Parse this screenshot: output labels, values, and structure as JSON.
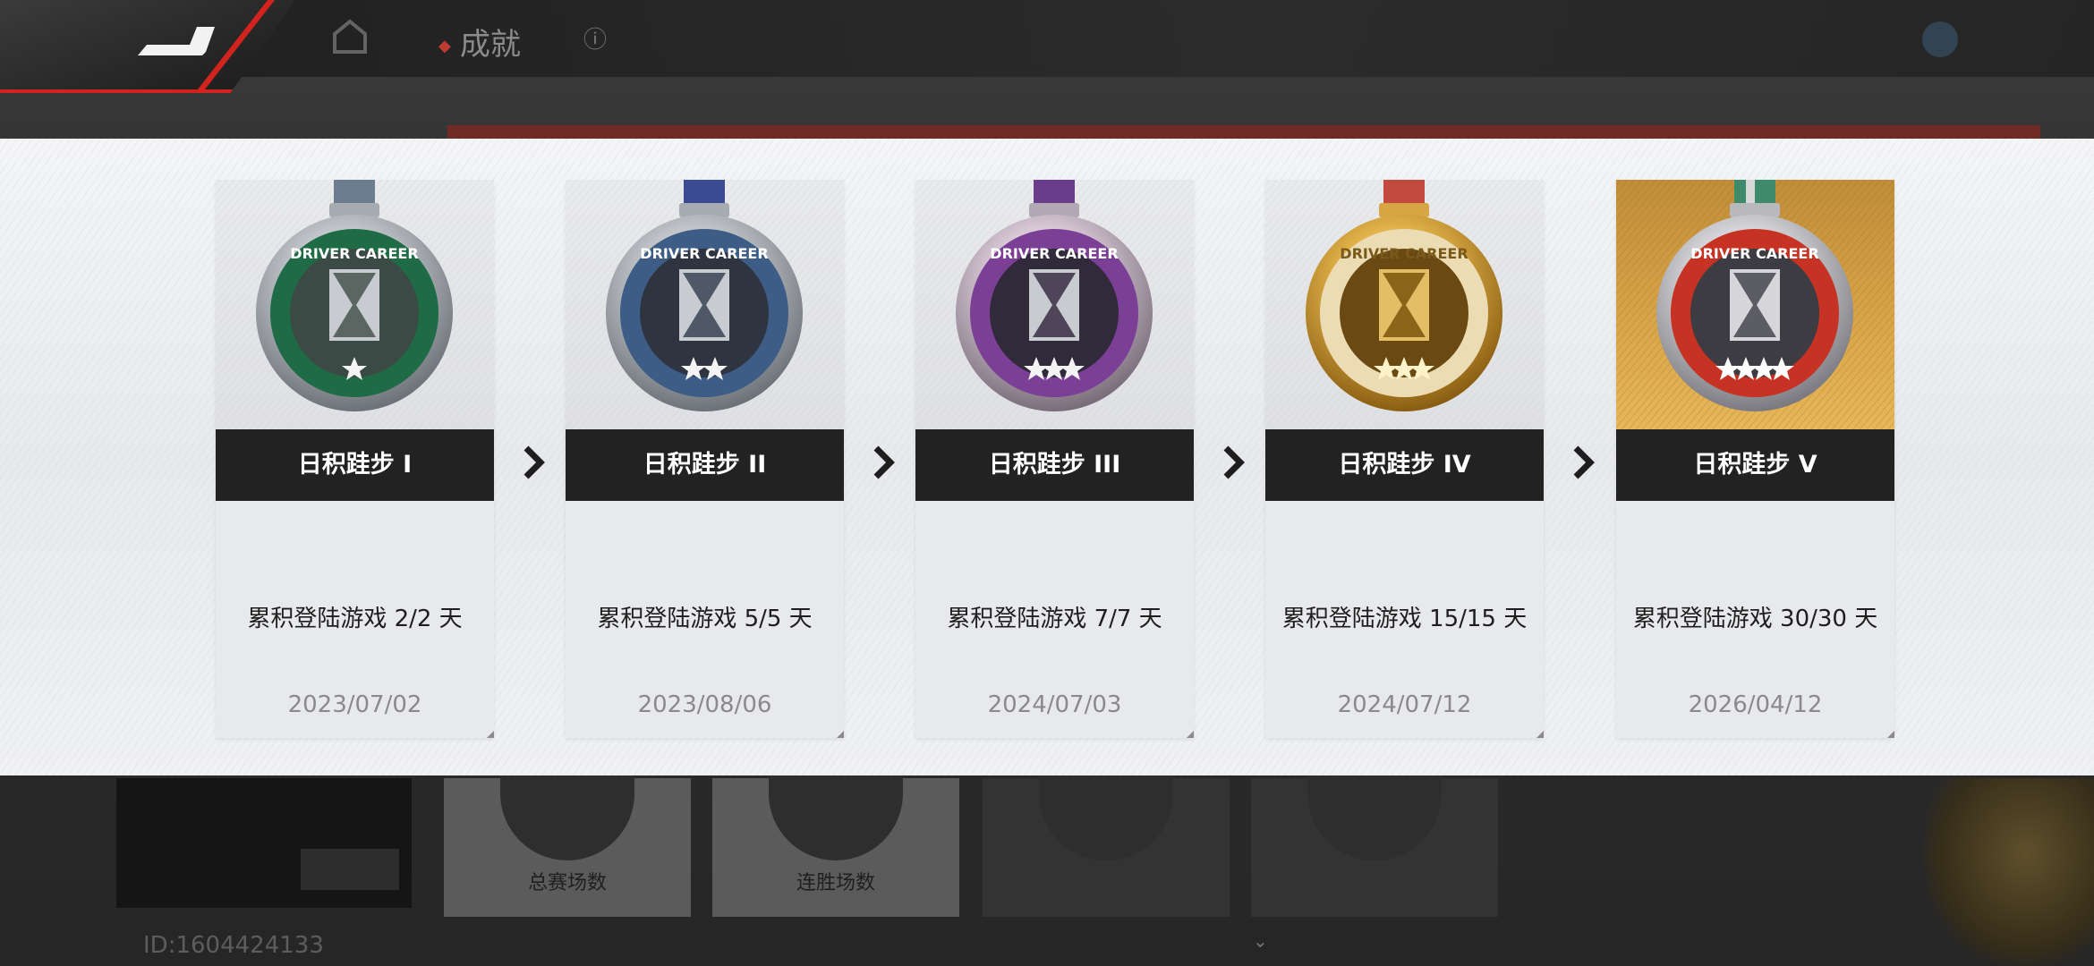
{
  "header": {
    "title": "成就",
    "info_icon": "info-circle-icon",
    "back_icon": "back-arrow-icon",
    "home_icon": "home-icon"
  },
  "background": {
    "player_id": "ID:1604424133",
    "cards": [
      "总赛场数",
      "连胜场数"
    ]
  },
  "colors": {
    "accent_red": "#d2231f",
    "title_bar": "#222222",
    "gold_bg": "#d9a448"
  },
  "achievements": [
    {
      "name": "日积跬步 I",
      "requirement": "累积登陆游戏 2/2 天",
      "date": "2023/07/02",
      "tier": "green",
      "stars": 1
    },
    {
      "name": "日积跬步 II",
      "requirement": "累积登陆游戏 5/5 天",
      "date": "2023/08/06",
      "tier": "blue",
      "stars": 2
    },
    {
      "name": "日积跬步 III",
      "requirement": "累积登陆游戏 7/7 天",
      "date": "2024/07/03",
      "tier": "purple",
      "stars": 3
    },
    {
      "name": "日积跬步 IV",
      "requirement": "累积登陆游戏 15/15 天",
      "date": "2024/07/12",
      "tier": "gold",
      "stars": 3
    },
    {
      "name": "日积跬步 V",
      "requirement": "累积登陆游戏 30/30 天",
      "date": "2026/04/12",
      "tier": "red",
      "stars": 4
    }
  ]
}
